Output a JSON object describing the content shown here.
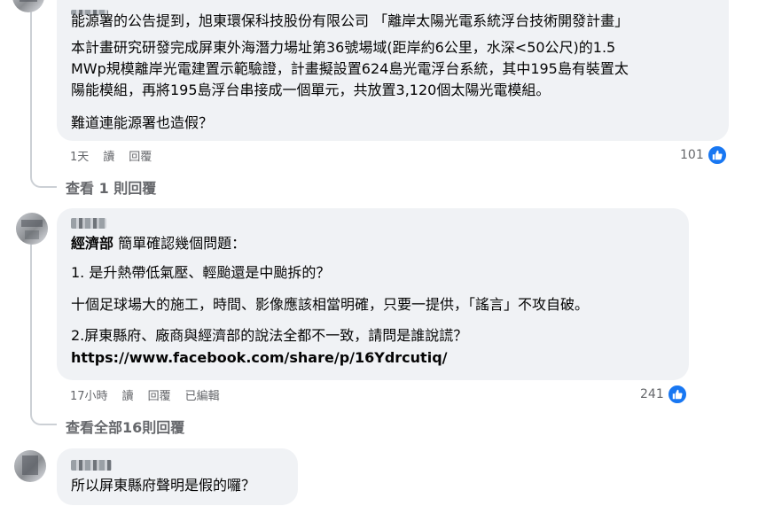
{
  "comment1": {
    "author_partial": "",
    "paragraphs": [
      "能源署的公告提到，旭東環保科技股份有限公司 「離岸太陽光電系統浮台技術開發計畫」",
      "本計畫研究研發完成屏東外海潛力場址第36號場域(距岸約6公里，水深<50公尺)的1.5",
      "MWp規模離岸光電建置示範驗證，計畫擬設置624島光電浮台系統，其中195島有裝置太",
      "陽能模組，再將195島浮台串接成一個單元，共放置3,120個太陽光電模組。",
      "難道連能源署也造假？"
    ],
    "time": "1天",
    "read": "讀",
    "reply": "回覆",
    "reaction_count": "101",
    "view_replies": "查看 1 則回覆"
  },
  "comment2": {
    "tagged_author": "經濟部",
    "first_line": " 簡單確認幾個問題：",
    "paragraphs": [
      "1. 是升熱帶低氣壓、輕颱還是中颱拆的？",
      "十個足球場大的施工，時間、影像應該相當明確，只要一提供，「謠言」不攻自破。",
      "2.屏東縣府、廠商與經濟部的說法全都不一致，請問是誰說謊？"
    ],
    "link": "https://www.facebook.com/share/p/16Ydrcutiq/",
    "time": "17小時",
    "read": "讀",
    "reply": "回覆",
    "edited": "已編輯",
    "reaction_count": "241",
    "view_replies": "查看全部16則回覆"
  },
  "comment3": {
    "text": "所以屏東縣府聲明是假的囉？"
  },
  "colors": {
    "like_blue": "#1877f2",
    "bubble_bg": "#f0f2f5",
    "meta_gray": "#65676b"
  }
}
